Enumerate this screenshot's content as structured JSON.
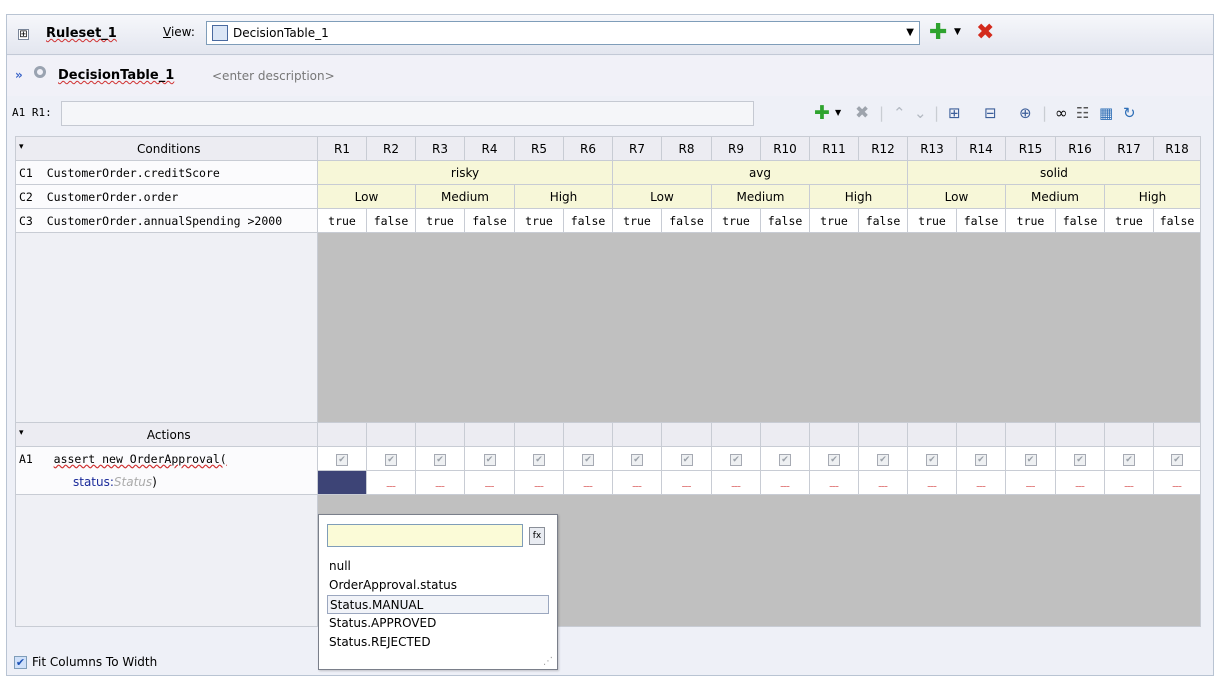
{
  "ruleset": {
    "expand_symbol": "⊞",
    "name": "Ruleset_1",
    "view_label": "View:",
    "view_value": "DecisionTable_1"
  },
  "decision_table": {
    "name": "DecisionTable_1",
    "description_placeholder": "<enter description>",
    "address_label": "A1 R1:",
    "address_value": ""
  },
  "conditions_header": "Conditions",
  "rule_columns": [
    "R1",
    "R2",
    "R3",
    "R4",
    "R5",
    "R6",
    "R7",
    "R8",
    "R9",
    "R10",
    "R11",
    "R12",
    "R13",
    "R14",
    "R15",
    "R16",
    "R17",
    "R18"
  ],
  "conditions": [
    {
      "id": "C1",
      "label": "CustomerOrder.creditScore",
      "groups": [
        {
          "text": "risky",
          "span": 6
        },
        {
          "text": "avg",
          "span": 6
        },
        {
          "text": "solid",
          "span": 6
        }
      ]
    },
    {
      "id": "C2",
      "label": "CustomerOrder.order",
      "groups": [
        {
          "text": "Low",
          "span": 2
        },
        {
          "text": "Medium",
          "span": 2
        },
        {
          "text": "High",
          "span": 2
        },
        {
          "text": "Low",
          "span": 2
        },
        {
          "text": "Medium",
          "span": 2
        },
        {
          "text": "High",
          "span": 2
        },
        {
          "text": "Low",
          "span": 2
        },
        {
          "text": "Medium",
          "span": 2
        },
        {
          "text": "High",
          "span": 2
        }
      ]
    },
    {
      "id": "C3",
      "label": "CustomerOrder.annualSpending >2000",
      "values": [
        "true",
        "false",
        "true",
        "false",
        "true",
        "false",
        "true",
        "false",
        "true",
        "false",
        "true",
        "false",
        "true",
        "false",
        "true",
        "false",
        "true",
        "false"
      ]
    }
  ],
  "actions_header": "Actions",
  "action": {
    "id": "A1",
    "label": "assert new OrderApproval(",
    "param_name": "status:",
    "param_type": "Status",
    "param_close": ")"
  },
  "popup": {
    "input_value": "",
    "options": [
      "null",
      "OrderApproval.status",
      "Status.MANUAL",
      "Status.APPROVED",
      "Status.REJECTED"
    ],
    "selected": "Status.MANUAL"
  },
  "fit_columns": {
    "label": "Fit Columns To Width",
    "checked": true
  },
  "colors": {
    "condition_cell": "#f7f7d8",
    "empty_area": "#c0c0c0",
    "selected_cell": "#3d4476",
    "add_green": "#2ea32e",
    "delete_red": "#d32a1c"
  },
  "icons": {
    "add": "plus-icon",
    "delete": "delete-icon",
    "move_up": "move-up-icon",
    "move_down": "move-down-icon",
    "binoculars": "binoculars-icon"
  }
}
